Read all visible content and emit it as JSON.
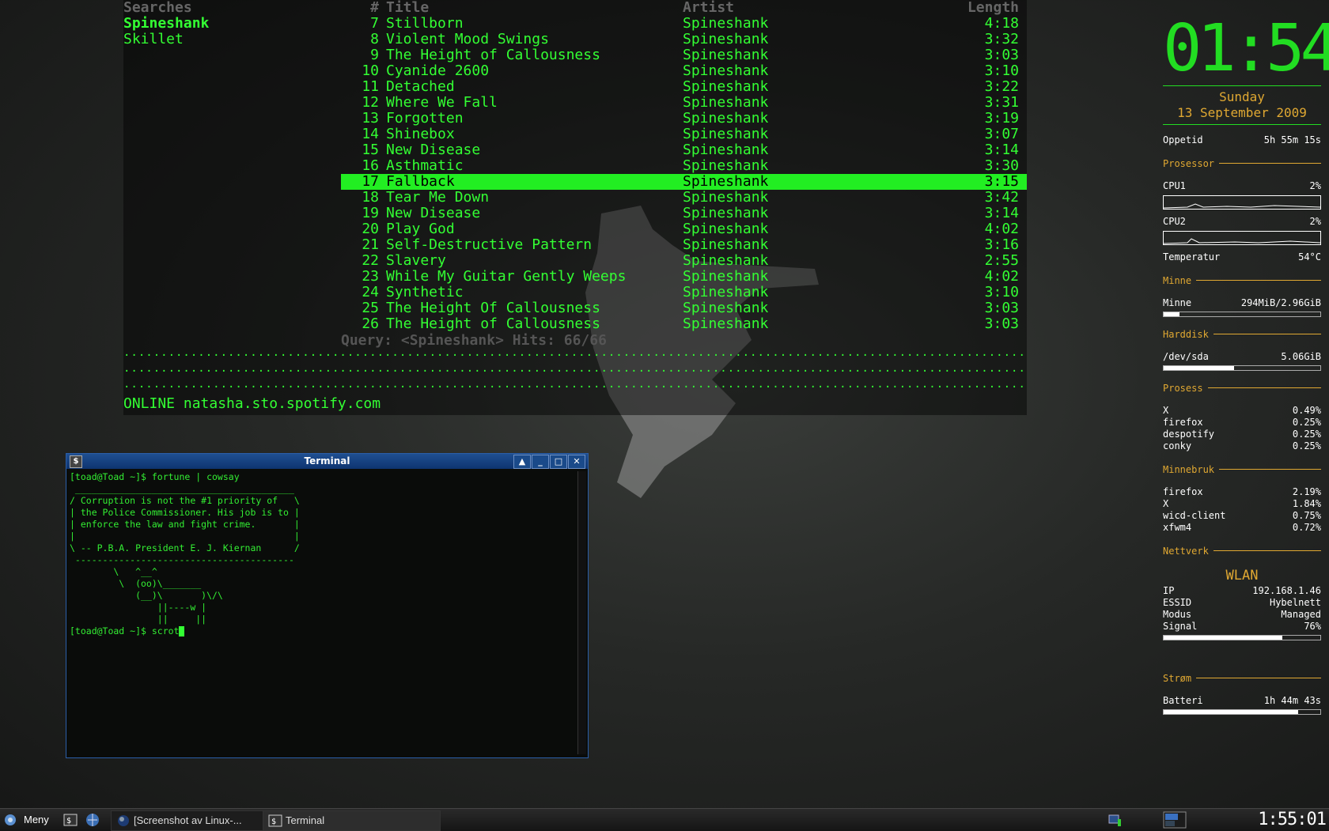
{
  "spotify": {
    "searches_header": "Searches",
    "searches": [
      "Spineshank",
      "Skillet"
    ],
    "columns": {
      "num": "#",
      "title": "Title",
      "artist": "Artist",
      "length": "Length"
    },
    "tracks": [
      {
        "num": "7",
        "title": "Stillborn",
        "artist": "Spineshank",
        "length": "4:18"
      },
      {
        "num": "8",
        "title": "Violent Mood Swings",
        "artist": "Spineshank",
        "length": "3:32"
      },
      {
        "num": "9",
        "title": "The Height of Callousness",
        "artist": "Spineshank",
        "length": "3:03"
      },
      {
        "num": "10",
        "title": "Cyanide 2600",
        "artist": "Spineshank",
        "length": "3:10"
      },
      {
        "num": "11",
        "title": "Detached",
        "artist": "Spineshank",
        "length": "3:22"
      },
      {
        "num": "12",
        "title": "Where We Fall",
        "artist": "Spineshank",
        "length": "3:31"
      },
      {
        "num": "13",
        "title": "Forgotten",
        "artist": "Spineshank",
        "length": "3:19"
      },
      {
        "num": "14",
        "title": "Shinebox",
        "artist": "Spineshank",
        "length": "3:07"
      },
      {
        "num": "15",
        "title": "New Disease",
        "artist": "Spineshank",
        "length": "3:14"
      },
      {
        "num": "16",
        "title": "Asthmatic",
        "artist": "Spineshank",
        "length": "3:30"
      },
      {
        "num": "17",
        "title": "Fallback",
        "artist": "Spineshank",
        "length": "3:15",
        "selected": true
      },
      {
        "num": "18",
        "title": "Tear Me Down",
        "artist": "Spineshank",
        "length": "3:42"
      },
      {
        "num": "19",
        "title": "New Disease",
        "artist": "Spineshank",
        "length": "3:14"
      },
      {
        "num": "20",
        "title": "Play God",
        "artist": "Spineshank",
        "length": "4:02"
      },
      {
        "num": "21",
        "title": "Self-Destructive Pattern",
        "artist": "Spineshank",
        "length": "3:16"
      },
      {
        "num": "22",
        "title": "Slavery",
        "artist": "Spineshank",
        "length": "2:55"
      },
      {
        "num": "23",
        "title": "While My Guitar Gently Weeps",
        "artist": "Spineshank",
        "length": "4:02"
      },
      {
        "num": "24",
        "title": "Synthetic",
        "artist": "Spineshank",
        "length": "3:10"
      },
      {
        "num": "25",
        "title": "The Height Of Callousness",
        "artist": "Spineshank",
        "length": "3:03"
      },
      {
        "num": "26",
        "title": "The Height of Callousness",
        "artist": "Spineshank",
        "length": "3:03"
      }
    ],
    "query": "Query: <Spineshank> Hits: 66/66",
    "status": "ONLINE natasha.sto.spotify.com"
  },
  "terminal": {
    "title": "Terminal",
    "content": "[toad@Toad ~]$ fortune | cowsay\n ________________________________________\n/ Corruption is not the #1 priority of   \\\n| the Police Commissioner. His job is to |\n| enforce the law and fight crime.       |\n|                                        |\n\\ -- P.B.A. President E. J. Kiernan      /\n ----------------------------------------\n        \\   ^__^\n         \\  (oo)\\_______\n            (__)\\       )\\/\\\n                ||----w |\n                ||     ||\n[toad@Toad ~]$ scrot"
  },
  "conky": {
    "time": "01:54",
    "day": "Sunday",
    "date": "13 September 2009",
    "uptime_label": "Oppetid",
    "uptime": "5h 55m 15s",
    "cpu_section": "Prosessor",
    "cpu1_label": "CPU1",
    "cpu1": "2%",
    "cpu2_label": "CPU2",
    "cpu2": "2%",
    "temp_label": "Temperatur",
    "temp": "54°C",
    "mem_section": "Minne",
    "mem_label": "Minne",
    "mem": "294MiB/2.96GiB",
    "mem_frac": 0.1,
    "disk_section": "Harddisk",
    "disk_label": "/dev/sda",
    "disk": "5.06GiB",
    "disk_frac": 0.45,
    "proc_section": "Prosess",
    "procs": [
      {
        "name": "X",
        "val": "0.49%"
      },
      {
        "name": "firefox",
        "val": "0.25%"
      },
      {
        "name": "despotify",
        "val": "0.25%"
      },
      {
        "name": "conky",
        "val": "0.25%"
      }
    ],
    "memuse_section": "Minnebruk",
    "memuse": [
      {
        "name": "firefox",
        "val": "2.19%"
      },
      {
        "name": "X",
        "val": "1.84%"
      },
      {
        "name": "wicd-client",
        "val": "0.75%"
      },
      {
        "name": "xfwm4",
        "val": "0.72%"
      }
    ],
    "net_section": "Nettverk",
    "wlan": "WLAN",
    "ip_label": "IP",
    "ip": "192.168.1.46",
    "essid_label": "ESSID",
    "essid": "Hybelnett",
    "mode_label": "Modus",
    "mode": "Managed",
    "signal_label": "Signal",
    "signal": "76%",
    "signal_frac": 0.76,
    "power_section": "Strøm",
    "battery_label": "Batteri",
    "battery": "1h 44m 43s",
    "battery_frac": 0.86
  },
  "taskbar": {
    "menu": "Meny",
    "tasks": [
      "[Screenshot av Linux-...",
      "Terminal"
    ],
    "clock": "1:55:01"
  }
}
